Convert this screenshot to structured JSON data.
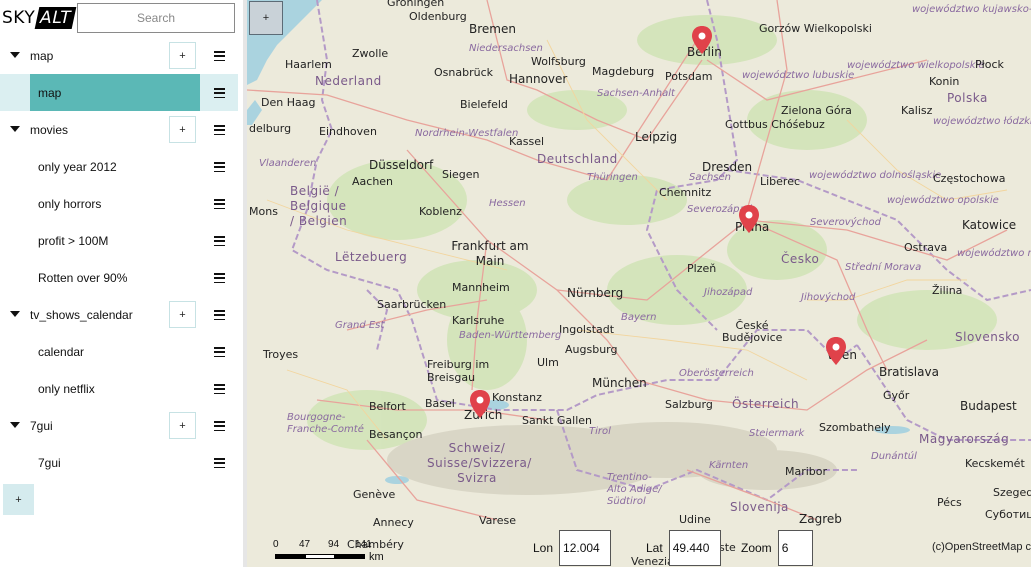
{
  "app": {
    "logo_part1": "SKY",
    "logo_part2": "ALT"
  },
  "search": {
    "placeholder": "Search"
  },
  "sidebar": {
    "items": [
      {
        "label": "map"
      },
      {
        "label": "map"
      },
      {
        "label": "movies"
      },
      {
        "label": "only year 2012"
      },
      {
        "label": "only horrors"
      },
      {
        "label": "profit > 100M"
      },
      {
        "label": "Rotten over 90%"
      },
      {
        "label": "tv_shows_calendar"
      },
      {
        "label": "calendar"
      },
      {
        "label": "only netflix"
      },
      {
        "label": "7gui"
      },
      {
        "label": "7gui"
      }
    ],
    "plus_label": "+",
    "add_label": "+"
  },
  "map": {
    "add_label": "+",
    "scale": {
      "ticks": [
        "0",
        "47",
        "94",
        "141"
      ],
      "unit": "km"
    },
    "lon_label": "Lon",
    "lon_value": "12.004",
    "lat_label": "Lat",
    "lat_value": "49.440",
    "zoom_label": "Zoom",
    "zoom_value": "6",
    "attribution": "(c)OpenStreetMap c",
    "pin_color": "#e0424a",
    "labels": {
      "groningen": "Groningen",
      "oldenburg": "Oldenburg",
      "bremen": "Bremen",
      "hamburg_region": "Niedersachsen",
      "hannover": "Hannover",
      "wolfsburg": "Wolfsburg",
      "berlin": "Berlin",
      "potsdam": "Potsdam",
      "gorzow": "Gorzów Wielkopolski",
      "kujawsko": "województwo kujawsko-pomorskie",
      "zwolle": "Zwolle",
      "haarlem": "Haarlem",
      "nederland": "Nederland",
      "osnabruck": "Osnabrück",
      "bielefeld": "Bielefeld",
      "magdeburg": "Magdeburg",
      "sachsen_anhalt": "Sachsen-Anhalt",
      "lubuskie": "województwo lubuskie",
      "wielkopolskie": "województwo wielkopolskie",
      "konin": "Konin",
      "polska": "Polska",
      "plock": "Płock",
      "den_haag": "Den Haag",
      "eindhoven": "Eindhoven",
      "delburg": "delburg",
      "nrw": "Nordrhein-Westfalen",
      "kassel": "Kassel",
      "leipzig": "Leipzig",
      "cottbus": "Cottbus Chóśebuz",
      "zielona": "Zielona Góra",
      "kalisz": "Kalisz",
      "lodzkie": "województwo łódzkie",
      "vlaanderen": "Vlaanderen",
      "dusseldorf": "Düsseldorf",
      "deutschland": "Deutschland",
      "dresden": "Dresden",
      "sachsen": "Sachsen",
      "aachen": "Aachen",
      "siegen": "Siegen",
      "thuringen": "Thüringen",
      "liberec": "Liberec",
      "dolnoslaskie": "województwo dolnośląskie",
      "czestochowa": "Częstochowa",
      "belgie": "België / Belgique / Belgien",
      "mons": "Mons",
      "koblenz": "Koblenz",
      "hessen": "Hessen",
      "chemnitz": "Chemnitz",
      "severozapad": "Severozápad",
      "praha": "Praha",
      "severovychod": "Severovýchod",
      "opolskie": "województwo opolskie",
      "katowice": "Katowice",
      "frankfurt": "Frankfurt am Main",
      "letzebuerg": "Lëtzebuerg",
      "cesko": "Česko",
      "ostrava": "Ostrava",
      "malopolskie": "województwo małopolskie",
      "plzen": "Plzeň",
      "stredni_morava": "Střední Morava",
      "mannheim": "Mannheim",
      "nurnberg": "Nürnberg",
      "jihozapad": "Jihozápad",
      "jihovychod": "Jihovýchod",
      "zilina": "Žilina",
      "saarbrucken": "Saarbrücken",
      "karlsruhe": "Karlsruhe",
      "bayern": "Bayern",
      "ceske_budejovice": "České Budějovice",
      "grand_est": "Grand Est",
      "ingolstadt": "Ingolstadt",
      "bw": "Baden-Württemberg",
      "augsburg": "Augsburg",
      "slovensko": "Slovensko",
      "troyes": "Troyes",
      "ulm": "Ulm",
      "wien": "Wien",
      "bratislava": "Bratislava",
      "freiburg": "Freiburg im Breisgau",
      "munchen": "München",
      "oberosterreich": "Oberösterreich",
      "belfort": "Belfort",
      "basel": "Basel",
      "konstanz": "Konstanz",
      "salzburg": "Salzburg",
      "osterreich": "Österreich",
      "gyor": "Győr",
      "budapest": "Budapest",
      "zurich": "Zürich",
      "sankt_gallen": "Sankt Gallen",
      "bourgogne": "Bourgogne-Franche-Comté",
      "besancon": "Besançon",
      "tirol": "Tirol",
      "steiermark": "Steiermark",
      "szombathely": "Szombathely",
      "magyarorszag": "Magyarország",
      "schweiz": "Schweiz/ Suisse/Svizzera/ Svizra",
      "karnten": "Kärnten",
      "dunantul": "Dunántúl",
      "kecskemet": "Kecskemét",
      "maribor": "Maribor",
      "trentino": "Trentino-Alto Adige/ Südtirol",
      "geneve": "Genève",
      "slovenija": "Slovenija",
      "pecs": "Pécs",
      "szeged": "Szeged",
      "subotica": "Суботица",
      "annecy": "Annecy",
      "varese": "Varese",
      "udine": "Udine",
      "zagreb": "Zagreb",
      "chambery": "Chambéry",
      "venezia": "Venezia",
      "trieste": "ste"
    }
  }
}
